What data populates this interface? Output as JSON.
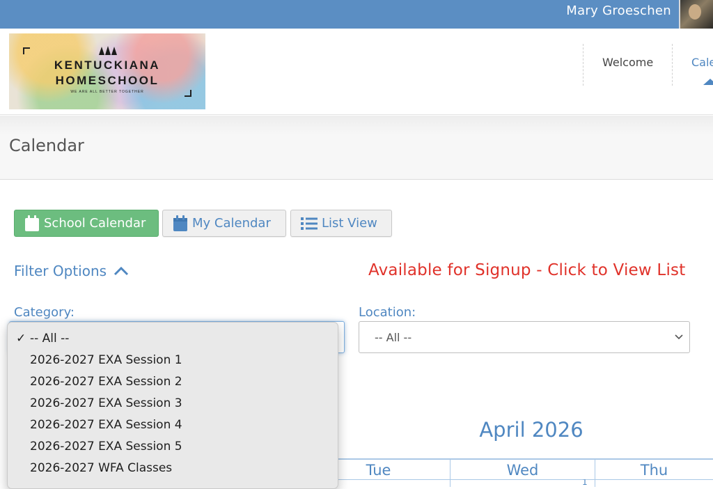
{
  "topbar": {
    "user_name": "Mary Groeschen"
  },
  "logo": {
    "line1": "KENTUCKIANA",
    "line2": "HOMESCHOOL",
    "tagline": "WE ARE ALL BETTER TOGETHER"
  },
  "nav": {
    "items": [
      {
        "label": "Welcome"
      },
      {
        "label": "Cale"
      }
    ]
  },
  "page": {
    "title": "Calendar"
  },
  "view_buttons": [
    {
      "label": "School Calendar"
    },
    {
      "label": "My Calendar"
    },
    {
      "label": "List View"
    }
  ],
  "filter": {
    "toggle_label": "Filter Options",
    "signup_link": "Available for Signup - Click to View List",
    "category_label": "Category:",
    "location_label": "Location:",
    "location_value": "-- All --"
  },
  "category_dropdown": {
    "selected_mark": "✓",
    "options": [
      "-- All --",
      "2026-2027 EXA Session 1",
      "2026-2027 EXA Session 2",
      "2026-2027 EXA Session 3",
      "2026-2027 EXA Session 4",
      "2026-2027 EXA Session 5",
      "2026-2027 WFA Classes"
    ]
  },
  "calendar": {
    "month_title": "April 2026",
    "day_headers": [
      "Tue",
      "Wed",
      "Thu"
    ],
    "visible_date": "1"
  },
  "colors": {
    "topbar": "#5b8ec3",
    "accent_blue": "#4f87c1",
    "signup_red": "#e0322a",
    "school_btn_green": "#6cbd7f"
  },
  "icons": [
    "calendar-icon",
    "list-icon",
    "chevron-up-icon",
    "chevron-down-icon",
    "checkmark-icon",
    "avatar"
  ]
}
